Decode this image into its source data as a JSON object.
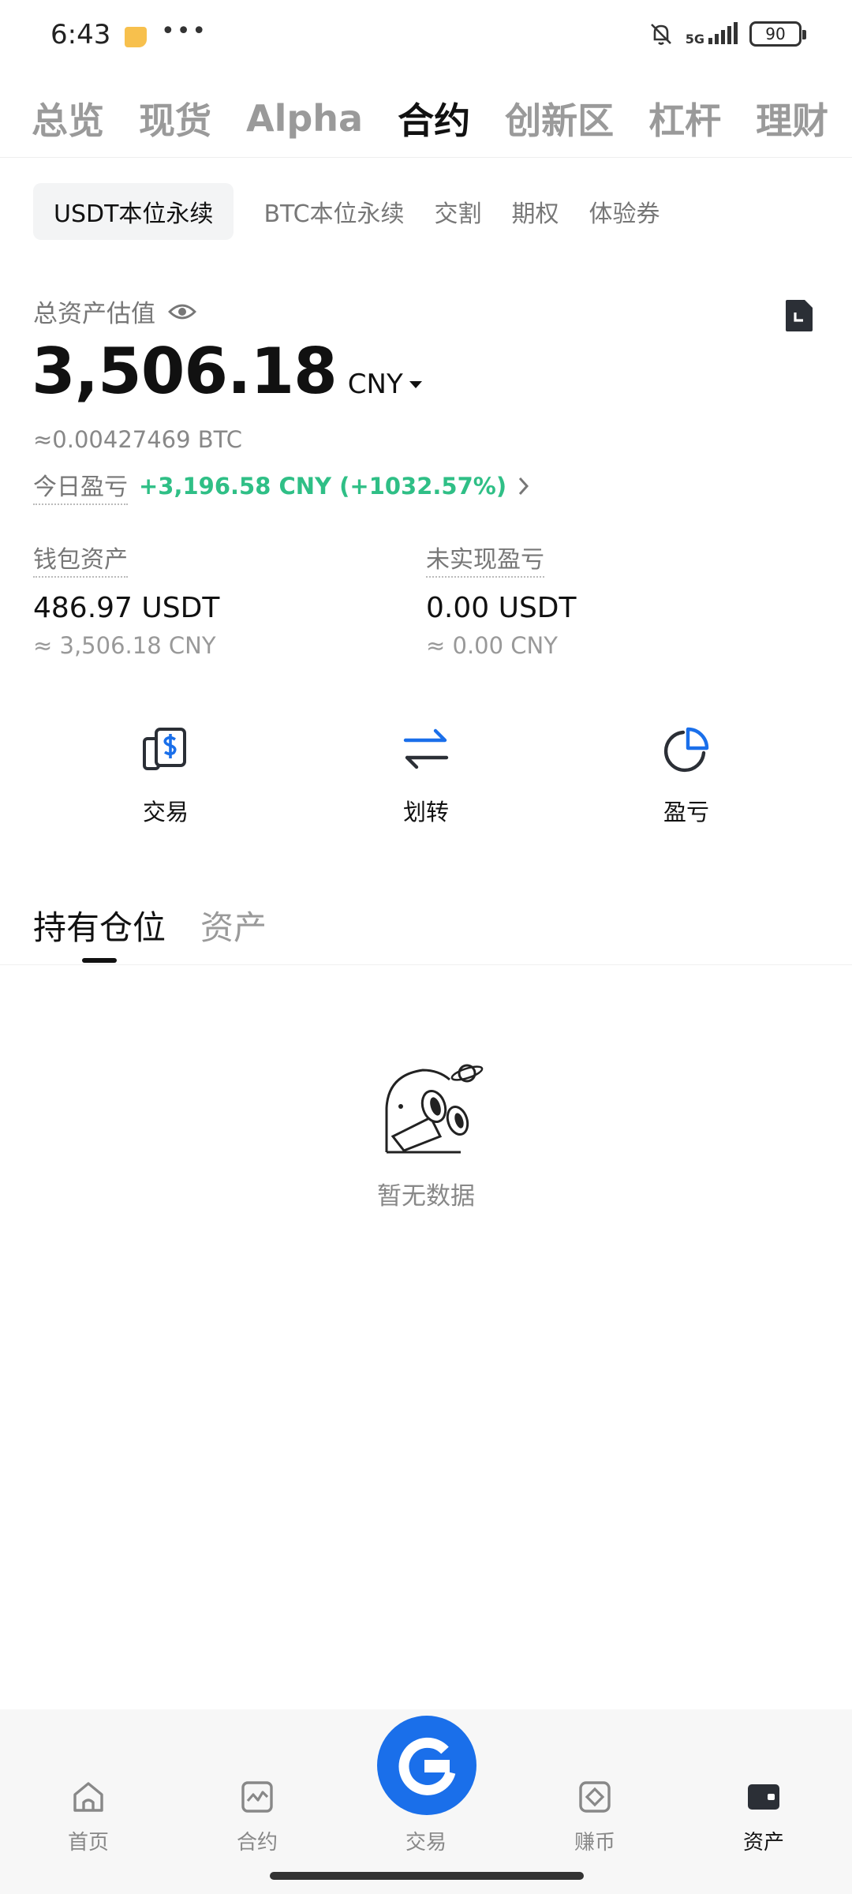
{
  "status": {
    "time": "6:43",
    "dots": "•••",
    "network": "5G",
    "battery": "90"
  },
  "top_tabs": [
    {
      "label": "总览"
    },
    {
      "label": "现货"
    },
    {
      "label": "Alpha"
    },
    {
      "label": "合约"
    },
    {
      "label": "创新区"
    },
    {
      "label": "杠杆"
    },
    {
      "label": "理财"
    }
  ],
  "top_tabs_active": "合约",
  "sub_tabs": [
    {
      "label": "USDT本位永续"
    },
    {
      "label": "BTC本位永续"
    },
    {
      "label": "交割"
    },
    {
      "label": "期权"
    },
    {
      "label": "体验券"
    }
  ],
  "summary": {
    "total_label": "总资产估值",
    "total_value": "3,506.18",
    "currency": "CNY",
    "btc_approx": "≈0.00427469 BTC",
    "today_pnl_label": "今日盈亏",
    "today_pnl_value": "+3,196.58 CNY (+1032.57%)"
  },
  "metrics": {
    "wallet": {
      "label": "钱包资产",
      "value": "486.97 USDT",
      "sub": "≈ 3,506.18 CNY"
    },
    "unrealized": {
      "label": "未实现盈亏",
      "value": "0.00 USDT",
      "sub": "≈ 0.00 CNY"
    }
  },
  "actions": {
    "trade": "交易",
    "transfer": "划转",
    "pnl": "盈亏"
  },
  "position_tabs": {
    "holdings": "持有仓位",
    "assets": "资产"
  },
  "empty_state": {
    "text": "暂无数据"
  },
  "bottom_nav": {
    "home": "首页",
    "futures": "合约",
    "trade": "交易",
    "earn": "赚币",
    "assets": "资产"
  },
  "colors": {
    "accent": "#1a6fea",
    "profit": "#2fbf86",
    "notification": "#f7c04d"
  }
}
